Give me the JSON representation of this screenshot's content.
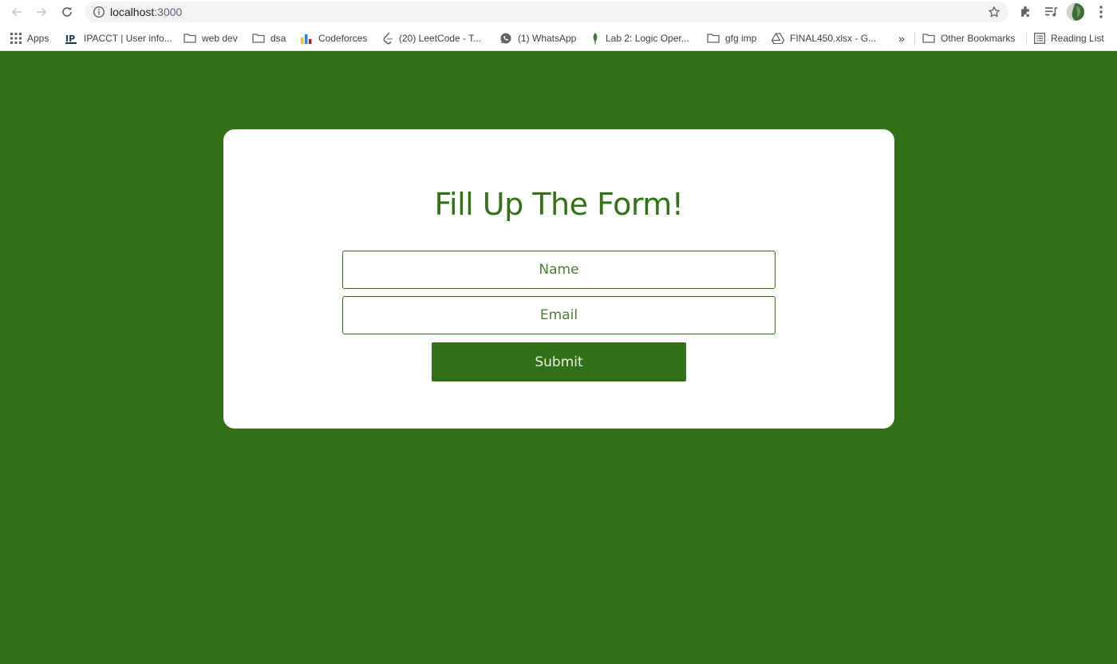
{
  "browser": {
    "url_host": "localhost",
    "url_port": ":3000",
    "bookmarks": [
      {
        "label": "Apps",
        "icon": "apps-grid-icon"
      },
      {
        "label": "IPACCT | User info...",
        "icon": "ipacct-icon"
      },
      {
        "label": "web dev",
        "icon": "folder-icon"
      },
      {
        "label": "dsa",
        "icon": "folder-icon"
      },
      {
        "label": "Codeforces",
        "icon": "codeforces-icon"
      },
      {
        "label": "(20) LeetCode - T...",
        "icon": "leetcode-icon"
      },
      {
        "label": "(1) WhatsApp",
        "icon": "whatsapp-icon"
      },
      {
        "label": "Lab 2: Logic Oper...",
        "icon": "leaf-icon"
      },
      {
        "label": "gfg imp",
        "icon": "folder-icon"
      },
      {
        "label": "FINAL450.xlsx - G...",
        "icon": "drive-icon"
      }
    ],
    "overflow_label": "»",
    "other_bookmarks": "Other Bookmarks",
    "reading_list": "Reading List"
  },
  "form": {
    "title": "Fill Up The Form!",
    "name_placeholder": "Name",
    "email_placeholder": "Email",
    "submit_label": "Submit"
  },
  "colors": {
    "page_background": "#327117",
    "card_background": "#ffffff",
    "accent": "#327117"
  }
}
